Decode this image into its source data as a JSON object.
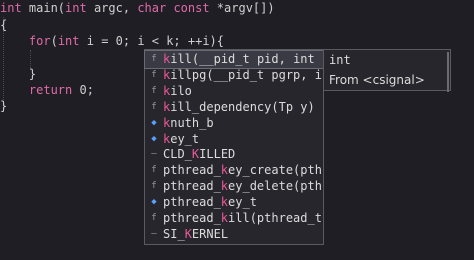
{
  "editor": {
    "lines": [
      {
        "parts": [
          {
            "t": "int",
            "c": "kw"
          },
          {
            "t": " main(",
            "c": "plain"
          },
          {
            "t": "int",
            "c": "kw"
          },
          {
            "t": " argc, ",
            "c": "plain"
          },
          {
            "t": "char",
            "c": "kw"
          },
          {
            "t": " ",
            "c": "plain"
          },
          {
            "t": "const",
            "c": "kw"
          },
          {
            "t": " *argv[])",
            "c": "plain"
          }
        ]
      },
      {
        "parts": [
          {
            "t": "{",
            "c": "plain"
          }
        ]
      },
      {
        "parts": [
          {
            "t": "    ",
            "c": "plain"
          },
          {
            "t": "for",
            "c": "kw"
          },
          {
            "t": "(",
            "c": "plain"
          },
          {
            "t": "int",
            "c": "kw"
          },
          {
            "t": " i = 0; i < k; ++i){",
            "c": "plain"
          }
        ]
      },
      {
        "parts": [
          {
            "t": "",
            "c": "plain"
          }
        ]
      },
      {
        "parts": [
          {
            "t": "    }",
            "c": "plain"
          }
        ]
      },
      {
        "parts": [
          {
            "t": "    ",
            "c": "plain"
          },
          {
            "t": "return",
            "c": "kw"
          },
          {
            "t": " 0;",
            "c": "plain"
          }
        ]
      },
      {
        "parts": [
          {
            "t": "}",
            "c": "plain"
          }
        ]
      }
    ]
  },
  "completion": {
    "items": [
      {
        "icon": "function-icon",
        "glyph": "f",
        "pre": "",
        "match": "k",
        "mid": "ill",
        "match2": "",
        "rest": "(__pid_t pid, int si…",
        "selected": true
      },
      {
        "icon": "function-icon",
        "glyph": "f",
        "pre": "",
        "match": "k",
        "mid": "illpg(__pid_t pgrp, int…",
        "match2": "",
        "rest": "",
        "selected": false
      },
      {
        "icon": "function-icon",
        "glyph": "f",
        "pre": "",
        "match": "k",
        "mid": "ilo",
        "match2": "",
        "rest": "",
        "selected": false
      },
      {
        "icon": "function-icon",
        "glyph": "f",
        "pre": "",
        "match": "k",
        "mid": "ill_dependency(Tp y)",
        "match2": "",
        "rest": "",
        "selected": false
      },
      {
        "icon": "variable-icon",
        "glyph": "◆",
        "pre": "",
        "match": "k",
        "mid": "nuth_b",
        "match2": "",
        "rest": "",
        "selected": false
      },
      {
        "icon": "variable-icon",
        "glyph": "◆",
        "pre": "",
        "match": "k",
        "mid": "ey_t",
        "match2": "",
        "rest": "",
        "selected": false
      },
      {
        "icon": "macro-icon",
        "glyph": "—",
        "pre": "CLD_",
        "match": "K",
        "mid": "ILLED",
        "match2": "",
        "rest": "",
        "selected": false
      },
      {
        "icon": "function-icon",
        "glyph": "f",
        "pre": "pthread_",
        "match": "k",
        "mid": "ey_create(pthre…",
        "match2": "",
        "rest": "",
        "selected": false
      },
      {
        "icon": "function-icon",
        "glyph": "f",
        "pre": "pthread_",
        "match": "k",
        "mid": "ey_delete(pthre…",
        "match2": "",
        "rest": "",
        "selected": false
      },
      {
        "icon": "variable-icon",
        "glyph": "◆",
        "pre": "pthread_",
        "match": "k",
        "mid": "ey_t",
        "match2": "",
        "rest": "",
        "selected": false
      },
      {
        "icon": "function-icon",
        "glyph": "f",
        "pre": "pthread_",
        "match": "k",
        "mid": "ill(pthread_t t…",
        "match2": "",
        "rest": "",
        "selected": false
      },
      {
        "icon": "macro-icon",
        "glyph": "—",
        "pre": "SI_",
        "match": "K",
        "mid": "ERNEL",
        "match2": "",
        "rest": "",
        "selected": false
      }
    ]
  },
  "detail": {
    "type": "int",
    "from": "From <csignal>"
  },
  "colors": {
    "background": "#1e1e24",
    "keyword": "#e06aa8",
    "match": "#e85a9a",
    "popup_bg": "#26262c"
  }
}
